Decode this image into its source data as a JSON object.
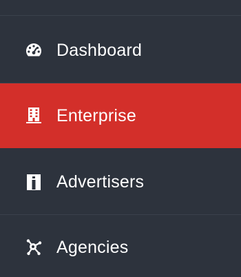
{
  "sidebar": {
    "colors": {
      "background": "#2d333d",
      "active": "#d32f2a",
      "divider": "#3a414c",
      "text": "#ffffff"
    },
    "items": [
      {
        "label": "Dashboard",
        "icon": "speedometer-icon",
        "active": false
      },
      {
        "label": "Enterprise",
        "icon": "building-icon",
        "active": true
      },
      {
        "label": "Advertisers",
        "icon": "id-badge-icon",
        "active": false
      },
      {
        "label": "Agencies",
        "icon": "network-icon",
        "active": false
      }
    ]
  }
}
